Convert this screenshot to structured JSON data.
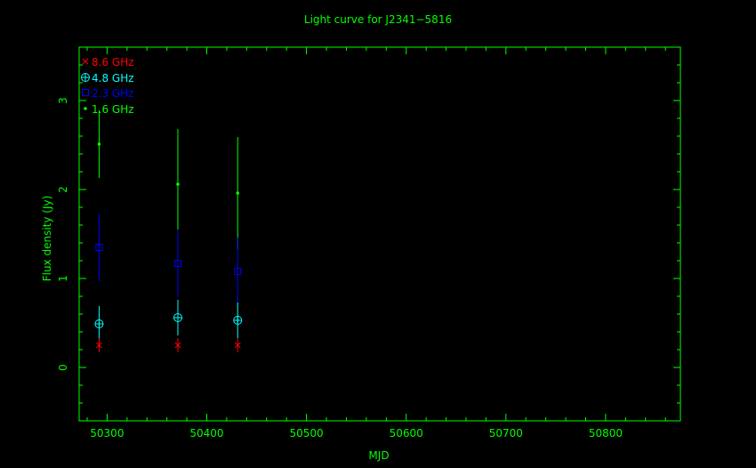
{
  "chart_data": {
    "type": "scatter",
    "title": "Light curve for J2341−5816",
    "xlabel": "MJD",
    "ylabel": "Flux density (Jy)",
    "xlim": [
      50272,
      50875
    ],
    "ylim": [
      -0.6,
      3.6
    ],
    "xticks": [
      50300,
      50400,
      50500,
      50600,
      50700,
      50800
    ],
    "xtick_labels": [
      "50300",
      "50400",
      "50500",
      "50600",
      "50700",
      "50800"
    ],
    "yticks": [
      0,
      1,
      2,
      3
    ],
    "ytick_labels": [
      "0",
      "1",
      "2",
      "3"
    ],
    "grid": false,
    "legend_position": "top-left",
    "axis_color": "#00ff00",
    "series": [
      {
        "name": "8.6 GHz",
        "color": "#ff0000",
        "marker": "x",
        "x": [
          50292,
          50371,
          50431
        ],
        "y": [
          0.25,
          0.25,
          0.25
        ],
        "err": [
          0.08,
          0.08,
          0.08
        ]
      },
      {
        "name": "4.8 GHz",
        "color": "#00ffff",
        "marker": "circle-plus",
        "x": [
          50292,
          50371,
          50431
        ],
        "y": [
          0.49,
          0.56,
          0.53
        ],
        "err": [
          0.2,
          0.2,
          0.2
        ]
      },
      {
        "name": "2.3 GHz",
        "color": "#0000ff",
        "marker": "square",
        "x": [
          50292,
          50371,
          50431
        ],
        "y": [
          1.35,
          1.17,
          1.08
        ],
        "err": [
          0.38,
          0.38,
          0.38
        ]
      },
      {
        "name": "1.6 GHz",
        "color": "#00ff00",
        "marker": "dot",
        "x": [
          50292,
          50371,
          50431
        ],
        "y": [
          2.51,
          2.06,
          1.96
        ],
        "err": [
          0.38,
          0.62,
          0.63
        ]
      }
    ]
  }
}
